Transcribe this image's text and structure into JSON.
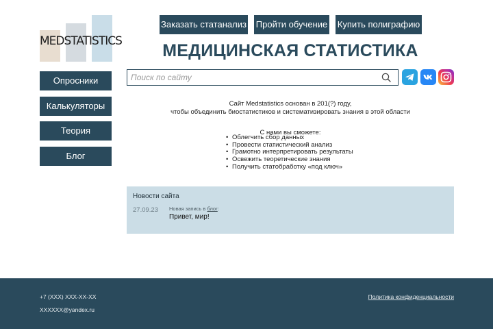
{
  "logo": {
    "text": "MEDSTATISTICS"
  },
  "top_buttons": [
    "Заказать статанализ",
    "Пройти обучение",
    "Купить полиграфию"
  ],
  "page_title": "МЕДИЦИНСКАЯ СТАТИСТИКА",
  "search": {
    "placeholder": "Поиск по сайту",
    "value": ""
  },
  "sidebar": {
    "items": [
      "Опросники",
      "Калькуляторы",
      "Теория",
      "Блог"
    ]
  },
  "social": {
    "icons": [
      "telegram-icon",
      "vk-icon",
      "instagram-icon"
    ]
  },
  "intro": {
    "line1": "Сайт Medstatistics основан в 201(?) году,",
    "line2": "чтобы объединить биостатистиков и систематизировать знания в этой области",
    "with_us": "С нами вы сможете:",
    "bullets": [
      "Облегчить сбор данных",
      "Провести статистический анализ",
      "Грамотно интерпретировать результаты",
      "Освежить теоретические знания",
      "Получить статобработку «под ключ»"
    ]
  },
  "news": {
    "title": "Новости сайта",
    "date": "27.09.23",
    "meta_prefix": "Новая запись в ",
    "meta_link": "блог",
    "meta_suffix": ":",
    "post_title": "Привет, мир!"
  },
  "footer": {
    "phone": "+7 (XXX) XXX-XX-XX",
    "email": "XXXXXX@yandex.ru",
    "policy": "Политика конфиденциальности"
  },
  "colors": {
    "primary": "#2a4a5c",
    "news_bg": "#cbdde6",
    "accent_telegram": "#2aa3e0",
    "accent_vk": "#2787f5"
  }
}
